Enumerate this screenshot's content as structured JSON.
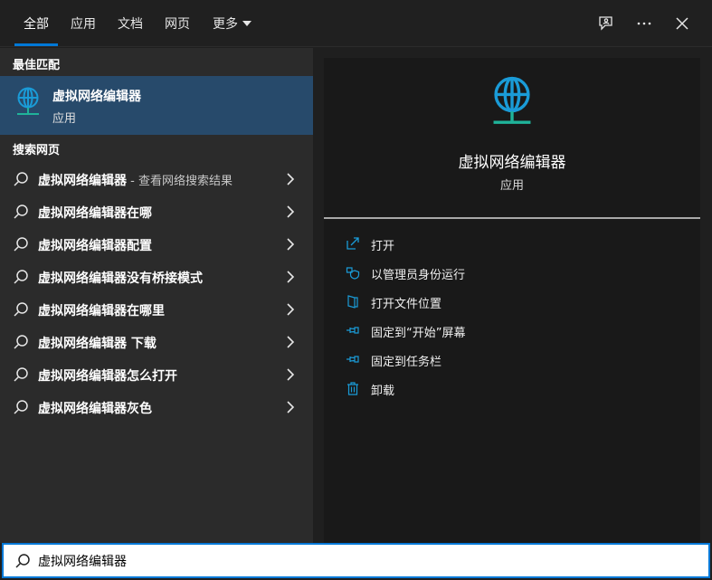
{
  "tabs": [
    {
      "label": "全部",
      "active": true
    },
    {
      "label": "应用",
      "active": false
    },
    {
      "label": "文档",
      "active": false
    },
    {
      "label": "网页",
      "active": false
    },
    {
      "label": "更多",
      "active": false
    }
  ],
  "top_icons": [
    "feedback-icon",
    "more-options-icon",
    "close-icon"
  ],
  "best_match": {
    "section_title": "最佳匹配",
    "name": "虚拟网络编辑器",
    "type": "应用"
  },
  "web_search": {
    "section_title": "搜索网页",
    "items": [
      {
        "text": "虚拟网络编辑器",
        "suffix": " - 查看网络搜索结果"
      },
      {
        "text": "虚拟网络编辑器在哪",
        "suffix": ""
      },
      {
        "text": "虚拟网络编辑器配置",
        "suffix": ""
      },
      {
        "text": "虚拟网络编辑器没有桥接模式",
        "suffix": ""
      },
      {
        "text": "虚拟网络编辑器在哪里",
        "suffix": ""
      },
      {
        "text": "虚拟网络编辑器 下载",
        "suffix": ""
      },
      {
        "text": "虚拟网络编辑器怎么打开",
        "suffix": ""
      },
      {
        "text": "虚拟网络编辑器灰色",
        "suffix": ""
      }
    ]
  },
  "detail": {
    "title": "虚拟网络编辑器",
    "subtitle": "应用",
    "actions": [
      {
        "label": "打开",
        "icon": "open-icon"
      },
      {
        "label": "以管理员身份运行",
        "icon": "shield-icon"
      },
      {
        "label": "打开文件位置",
        "icon": "file-location-icon"
      },
      {
        "label": "固定到“开始”屏幕",
        "icon": "pin-icon"
      },
      {
        "label": "固定到任务栏",
        "icon": "pin-icon"
      },
      {
        "label": "卸载",
        "icon": "trash-icon"
      }
    ]
  },
  "search": {
    "value": "虚拟网络编辑器"
  },
  "colors": {
    "accent": "#0078d7",
    "selected_row": "#274a6b",
    "globe_blue": "#1a9bd7",
    "globe_base": "#1fb39a"
  }
}
